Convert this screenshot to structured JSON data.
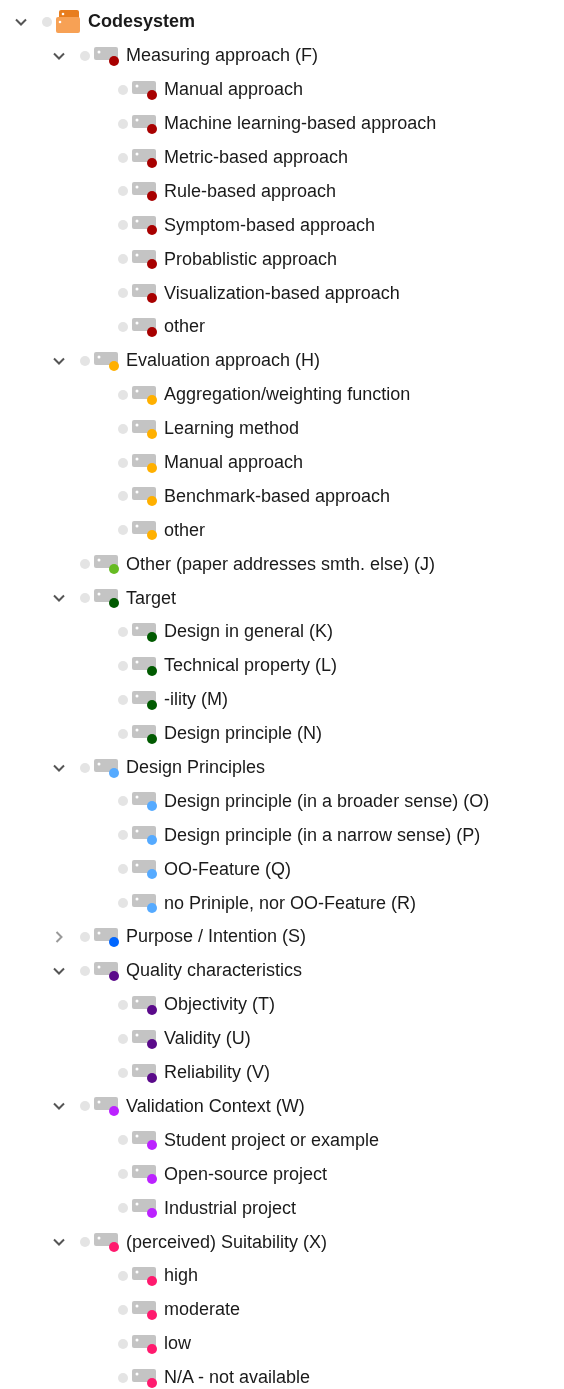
{
  "tree": {
    "label": "Codesystem",
    "expanded": true,
    "children": [
      {
        "label": "Measuring approach (F)",
        "color": "#a80000",
        "expanded": true,
        "children": [
          {
            "label": "Manual approach",
            "color": "#a80000"
          },
          {
            "label": "Machine learning-based approach",
            "color": "#a80000"
          },
          {
            "label": "Metric-based approach",
            "color": "#a80000"
          },
          {
            "label": "Rule-based approach",
            "color": "#a80000"
          },
          {
            "label": "Symptom-based approach",
            "color": "#a80000"
          },
          {
            "label": "Probablistic approach",
            "color": "#a80000"
          },
          {
            "label": "Visualization-based approach",
            "color": "#a80000"
          },
          {
            "label": "other",
            "color": "#a80000"
          }
        ]
      },
      {
        "label": "Evaluation approach (H)",
        "color": "#ffb000",
        "expanded": true,
        "children": [
          {
            "label": "Aggregation/weighting function",
            "color": "#ffb000"
          },
          {
            "label": "Learning method",
            "color": "#ffb000"
          },
          {
            "label": "Manual approach",
            "color": "#ffb000"
          },
          {
            "label": "Benchmark-based approach",
            "color": "#ffb000"
          },
          {
            "label": "other",
            "color": "#ffb000"
          }
        ]
      },
      {
        "label": "Other (paper addresses smth. else) (J)",
        "color": "#66bb22"
      },
      {
        "label": "Target",
        "color": "#005a00",
        "expanded": true,
        "children": [
          {
            "label": "Design in general (K)",
            "color": "#005a00"
          },
          {
            "label": "Technical property (L)",
            "color": "#005a00"
          },
          {
            "label": "-ility (M)",
            "color": "#005a00"
          },
          {
            "label": "Design principle (N)",
            "color": "#005a00"
          }
        ]
      },
      {
        "label": "Design Principles",
        "color": "#55aaff",
        "expanded": true,
        "children": [
          {
            "label": "Design principle (in a broader sense) (O)",
            "color": "#55aaff"
          },
          {
            "label": "Design principle (in a narrow sense) (P)",
            "color": "#55aaff"
          },
          {
            "label": "OO-Feature (Q)",
            "color": "#55aaff"
          },
          {
            "label": "no Priniple, nor OO-Feature (R)",
            "color": "#55aaff"
          }
        ]
      },
      {
        "label": "Purpose / Intention (S)",
        "color": "#0066ff",
        "expanded": false
      },
      {
        "label": "Quality characteristics",
        "color": "#5a0a8a",
        "expanded": true,
        "children": [
          {
            "label": "Objectivity (T)",
            "color": "#5a0a8a"
          },
          {
            "label": "Validity (U)",
            "color": "#5a0a8a"
          },
          {
            "label": "Reliability (V)",
            "color": "#5a0a8a"
          }
        ]
      },
      {
        "label": "Validation Context (W)",
        "color": "#bb22ff",
        "expanded": true,
        "children": [
          {
            "label": "Student project or example",
            "color": "#bb22ff"
          },
          {
            "label": "Open-source project",
            "color": "#bb22ff"
          },
          {
            "label": "Industrial project",
            "color": "#bb22ff"
          }
        ]
      },
      {
        "label": "(perceived) Suitability (X)",
        "color": "#ff1a6e",
        "expanded": true,
        "children": [
          {
            "label": "high",
            "color": "#ff1a6e"
          },
          {
            "label": "moderate",
            "color": "#ff1a6e"
          },
          {
            "label": "low",
            "color": "#ff1a6e"
          },
          {
            "label": "N/A - not available",
            "color": "#ff1a6e"
          }
        ]
      }
    ]
  }
}
